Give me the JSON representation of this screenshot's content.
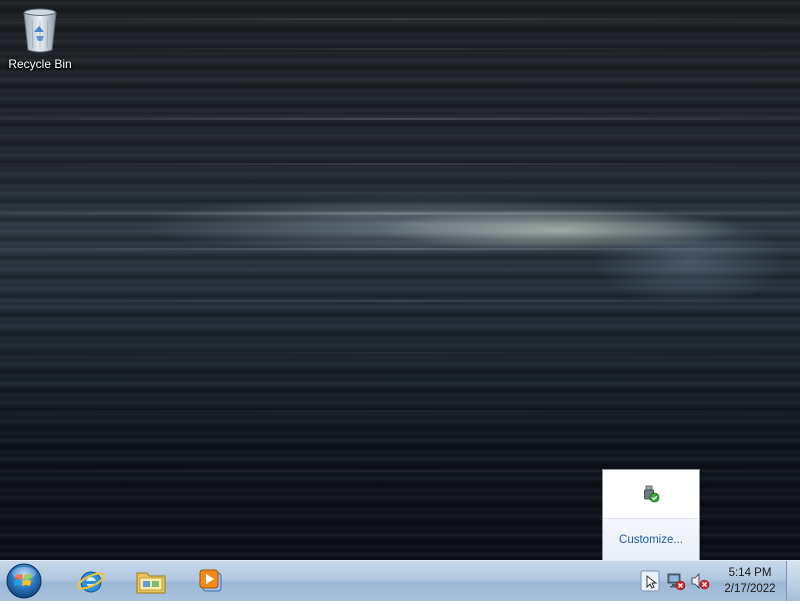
{
  "desktop": {
    "icons": [
      {
        "label": "Recycle Bin",
        "icon": "recycle-bin-icon"
      }
    ]
  },
  "flyout": {
    "icons": [
      "usb-safely-remove-icon"
    ],
    "customize_label": "Customize..."
  },
  "taskbar": {
    "start_icon": "windows-start-orb-icon",
    "pinned": [
      {
        "icon": "internet-explorer-icon"
      },
      {
        "icon": "windows-explorer-folder-icon"
      },
      {
        "icon": "windows-media-player-icon"
      }
    ],
    "tray_icons": [
      "show-hidden-icons-arrow-icon",
      "network-disconnected-icon",
      "volume-muted-icon"
    ],
    "clock": {
      "time": "5:14 PM",
      "date": "2/17/2022"
    }
  },
  "colors": {
    "taskbar": "#b1c8e0",
    "link": "#1e5aa8"
  }
}
